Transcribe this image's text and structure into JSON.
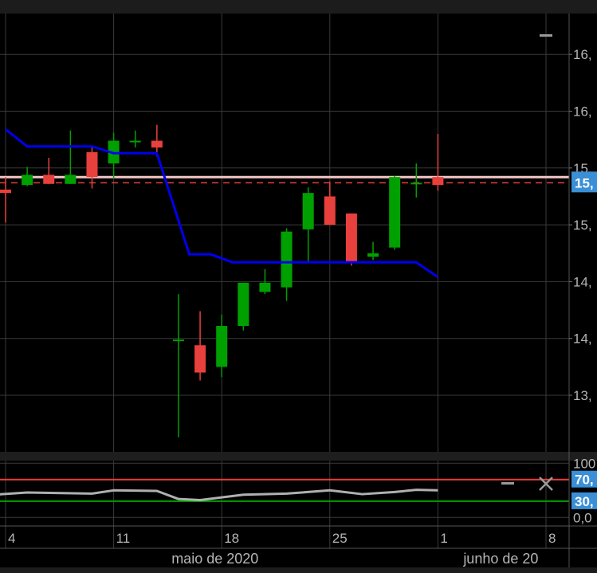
{
  "chart_data": {
    "type": "candlestick",
    "price_axis": {
      "ticks": [
        {
          "label": "16,",
          "value": 16.5
        },
        {
          "label": "16,",
          "value": 16.0
        },
        {
          "label": "15,",
          "value": 15.5
        },
        {
          "label": "15,",
          "value": 15.0
        },
        {
          "label": "14,",
          "value": 14.5
        },
        {
          "label": "14,",
          "value": 14.0
        },
        {
          "label": "13,",
          "value": 13.5
        }
      ],
      "current_price_label": "15,",
      "current_price": 15.37,
      "reference_line": 15.42
    },
    "candles": [
      {
        "day": 0,
        "open": 15.31,
        "high": 15.42,
        "low": 15.02,
        "close": 15.28
      },
      {
        "day": 2,
        "open": 15.35,
        "high": 15.51,
        "low": 15.34,
        "close": 15.44
      },
      {
        "day": 4,
        "open": 15.44,
        "high": 15.59,
        "low": 15.36,
        "close": 15.36
      },
      {
        "day": 6,
        "open": 15.36,
        "high": 15.83,
        "low": 15.36,
        "close": 15.44
      },
      {
        "day": 8,
        "open": 15.64,
        "high": 15.68,
        "low": 15.32,
        "close": 15.42
      },
      {
        "day": 10,
        "open": 15.54,
        "high": 15.81,
        "low": 15.41,
        "close": 15.74
      },
      {
        "day": 12,
        "open": 15.74,
        "high": 15.83,
        "low": 15.68,
        "close": 15.74
      },
      {
        "day": 14,
        "open": 15.74,
        "high": 15.88,
        "low": 15.6,
        "close": 15.68
      },
      {
        "day": 16,
        "open": 13.99,
        "high": 14.39,
        "low": 13.13,
        "close": 13.99
      },
      {
        "day": 18,
        "open": 13.94,
        "high": 14.24,
        "low": 13.63,
        "close": 13.7
      },
      {
        "day": 20,
        "open": 13.75,
        "high": 14.21,
        "low": 13.66,
        "close": 14.11
      },
      {
        "day": 22,
        "open": 14.11,
        "high": 14.49,
        "low": 14.07,
        "close": 14.49
      },
      {
        "day": 24,
        "open": 14.41,
        "high": 14.61,
        "low": 14.39,
        "close": 14.49
      },
      {
        "day": 26,
        "open": 14.45,
        "high": 14.97,
        "low": 14.33,
        "close": 14.94
      },
      {
        "day": 28,
        "open": 14.96,
        "high": 15.33,
        "low": 14.68,
        "close": 15.28
      },
      {
        "day": 30,
        "open": 15.25,
        "high": 15.38,
        "low": 15.0,
        "close": 15.0
      },
      {
        "day": 32,
        "open": 15.1,
        "high": 15.1,
        "low": 14.64,
        "close": 14.67
      },
      {
        "day": 34,
        "open": 14.72,
        "high": 14.85,
        "low": 14.69,
        "close": 14.75
      },
      {
        "day": 36,
        "open": 14.8,
        "high": 15.43,
        "low": 14.78,
        "close": 15.42
      },
      {
        "day": 38,
        "open": 15.37,
        "high": 15.54,
        "low": 15.24,
        "close": 15.37
      },
      {
        "day": 40,
        "open": 15.42,
        "high": 15.8,
        "low": 15.3,
        "close": 15.35
      }
    ],
    "overlay_line": {
      "color": "#0000ee",
      "points": [
        [
          0,
          15.84
        ],
        [
          2,
          15.69
        ],
        [
          8,
          15.69
        ],
        [
          10,
          15.63
        ],
        [
          14,
          15.63
        ],
        [
          17,
          14.74
        ],
        [
          19,
          14.74
        ],
        [
          21,
          14.67
        ],
        [
          38,
          14.67
        ],
        [
          40,
          14.54
        ]
      ]
    },
    "x_axis": {
      "ticks": [
        {
          "label": "4",
          "day": 0
        },
        {
          "label": "11",
          "day": 10
        },
        {
          "label": "18",
          "day": 20
        },
        {
          "label": "25",
          "day": 30
        },
        {
          "label": "1",
          "day": 40
        },
        {
          "label": "8",
          "day": 50
        }
      ],
      "months": [
        {
          "label": "maio de 2020",
          "day": 20
        },
        {
          "label": "junho de 20",
          "day": 47
        }
      ]
    },
    "oscillator": {
      "axis_labels": [
        {
          "label": "100",
          "value": 100
        },
        {
          "label": "70,",
          "value": 70
        },
        {
          "label": "30,",
          "value": 30
        },
        {
          "label": "0,0",
          "value": 0
        }
      ],
      "upper_band": 70,
      "lower_band": 30,
      "line": [
        [
          -1,
          42
        ],
        [
          2,
          46
        ],
        [
          8,
          44
        ],
        [
          10,
          50
        ],
        [
          14,
          49
        ],
        [
          16,
          34
        ],
        [
          18,
          32
        ],
        [
          22,
          42
        ],
        [
          26,
          44
        ],
        [
          30,
          50
        ],
        [
          33,
          43
        ],
        [
          36,
          47
        ],
        [
          38,
          51
        ],
        [
          40,
          50
        ]
      ]
    },
    "colors": {
      "background": "#000000",
      "grid": "#3a3a3a",
      "up": "#00a000",
      "down": "#e8403c",
      "price_badge": "#3a8fd6",
      "upper_band": "#e8403c",
      "lower_band": "#00a000",
      "oscillator_line": "#b0b0b0"
    }
  }
}
